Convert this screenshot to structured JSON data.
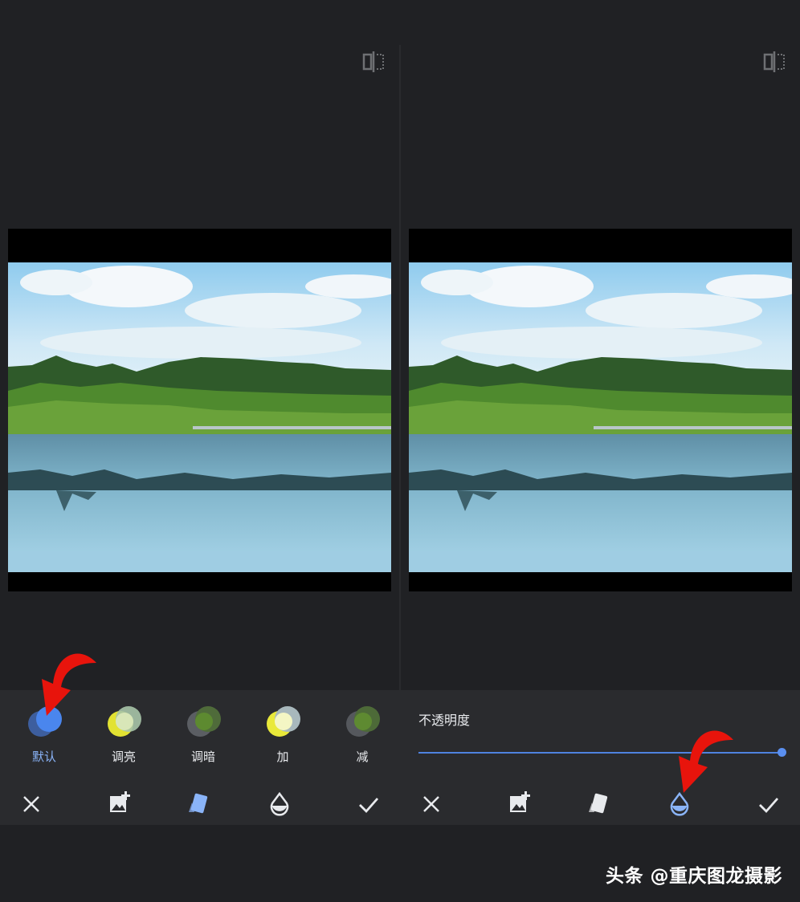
{
  "left_panel": {
    "blend_modes": [
      {
        "label": "默认",
        "active": true
      },
      {
        "label": "调亮",
        "active": false
      },
      {
        "label": "调暗",
        "active": false
      },
      {
        "label": "加",
        "active": false
      },
      {
        "label": "减",
        "active": false
      }
    ],
    "toolbar": [
      "close-icon",
      "add-image-icon",
      "blend-mode-icon",
      "opacity-icon",
      "check-icon"
    ],
    "active_tool": "blend-mode-icon"
  },
  "right_panel": {
    "opacity_label": "不透明度",
    "opacity_value": 1.0,
    "toolbar": [
      "close-icon",
      "add-image-icon",
      "blend-mode-icon",
      "opacity-icon",
      "check-icon"
    ],
    "active_tool": "opacity-icon"
  },
  "colors": {
    "accent": "#8ab4f8",
    "panel_bg": "#202124",
    "tray_bg": "#2a2b2e",
    "annotation_arrow": "#e8140c"
  },
  "watermark": "头条 @重庆图龙摄影"
}
